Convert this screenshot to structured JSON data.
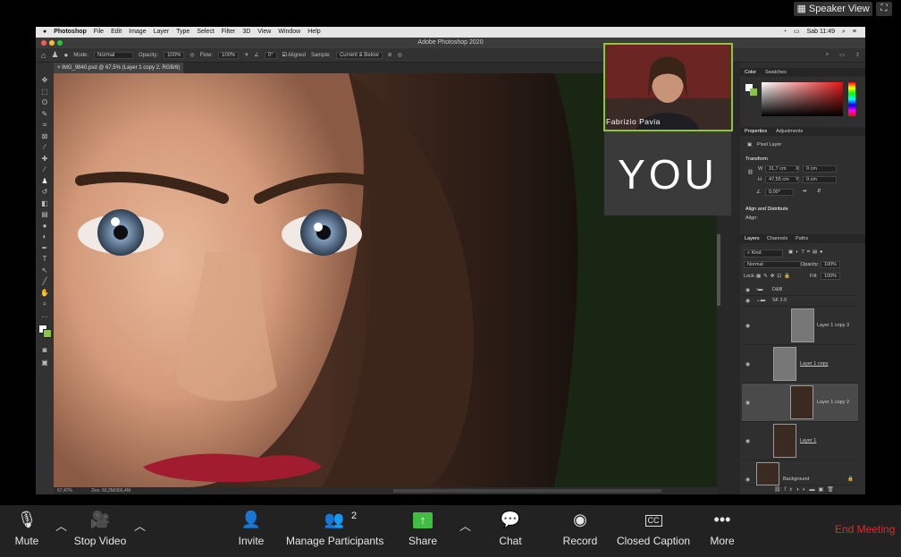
{
  "zoom": {
    "speaker_view": "Speaker View",
    "participant_name": "Fabrizio Pavia",
    "you_label": "YOU",
    "participants_count": "2",
    "toolbar": {
      "mute": "Mute",
      "stop_video": "Stop Video",
      "invite": "Invite",
      "manage_participants": "Manage Participants",
      "share": "Share",
      "chat": "Chat",
      "record": "Record",
      "closed_caption": "Closed Caption",
      "more": "More",
      "end_meeting": "End Meeting"
    },
    "colors": {
      "share": "#3fbf3f",
      "end": "#e02828",
      "active_border": "#8cc63f"
    }
  },
  "mac": {
    "menu": [
      "Photoshop",
      "File",
      "Edit",
      "Image",
      "Layer",
      "Type",
      "Select",
      "Filter",
      "3D",
      "View",
      "Window",
      "Help"
    ],
    "clock": "Sab 11:49"
  },
  "photoshop": {
    "app_title": "Adobe Photoshop 2020",
    "options": {
      "mode_label": "Mode:",
      "mode_value": "Normal",
      "opacity_label": "Opacity:",
      "opacity_value": "100%",
      "flow_label": "Flow:",
      "flow_value": "100%",
      "angle_value": "0°",
      "aligned_label": "Aligned",
      "sample_label": "Sample:",
      "sample_value": "Current & Below"
    },
    "doc_tab": "IMG_9840.psd @ 67,5% (Layer 1 copy 2, RGB/8)",
    "status": {
      "zoom": "67,47%",
      "doc": "Doc: 60,2M/366,4M"
    },
    "panels": {
      "color_tab": "Color",
      "swatches_tab": "Swatches",
      "properties_tab": "Properties",
      "adjustments_tab": "Adjustments",
      "pixel_layer": "Pixel Layer",
      "transform": "Transform",
      "w": "W",
      "w_value": "31,7 cm",
      "h": "H",
      "h_value": "47,55 cm",
      "x": "X",
      "x_value": "0 cm",
      "y": "Y",
      "y_value": "0 cm",
      "angle_value": "0,00°",
      "align": "Align and Distribute",
      "align_label": "Align:",
      "layers_tab": "Layers",
      "channels_tab": "Channels",
      "paths_tab": "Paths",
      "kind": "Kind",
      "blend": "Normal",
      "opacity_label": "Opacity:",
      "opacity_value": "100%",
      "lock_label": "Lock:",
      "fill_label": "Fill:",
      "fill_value": "100%"
    },
    "layers": [
      {
        "name": "D&B",
        "type": "group"
      },
      {
        "name": "SF 2.0",
        "type": "group"
      },
      {
        "name": "Layer 1 copy 3",
        "type": "layer"
      },
      {
        "name": "Layer 1 copy",
        "type": "layer"
      },
      {
        "name": "Layer 1 copy 2",
        "type": "layer"
      },
      {
        "name": "Layer 1",
        "type": "layer"
      },
      {
        "name": "Background",
        "type": "layer"
      }
    ]
  }
}
